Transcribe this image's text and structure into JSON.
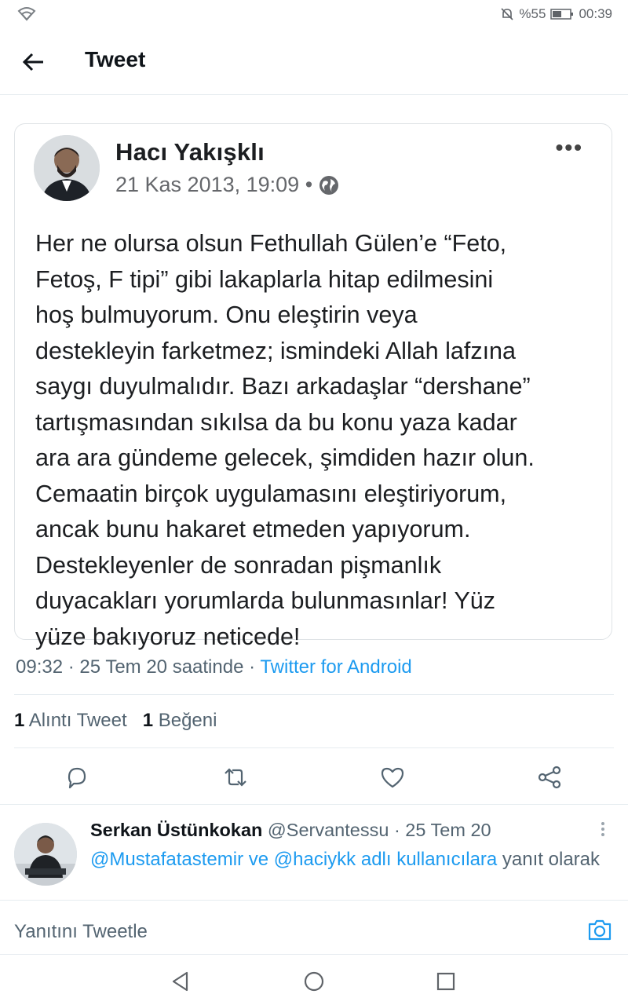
{
  "status_bar": {
    "battery": "%55",
    "time": "00:39"
  },
  "header": {
    "title": "Tweet"
  },
  "embedded_post": {
    "author": "Hacı Yakışklı",
    "date": "21 Kas 2013, 19:09 •",
    "more": "•••",
    "text": "Her ne olursa olsun Fethullah Gülen’e “Feto,\nFetoş, F tipi” gibi lakaplarla hitap edilmesini\nhoş bulmuyorum. Onu eleştirin veya\ndestekleyin farketmez; ismindeki Allah lafzına\nsaygı duyulmalıdır. Bazı arkadaşlar “dershane”\ntartışmasından sıkılsa da bu konu yaza kadar\nara ara gündeme gelecek, şimdiden hazır olun.\nCemaatin birçok uygulamasını eleştiriyorum,\nancak bunu hakaret etmeden yapıyorum.\nDestekleyenler de sonradan pişmanlık\nduyacakları yorumlarda bulunmasınlar! Yüz\nyüze bakıyoruz neticede!"
  },
  "tweet_meta": {
    "time_date": "09:32 · 25 Tem 20 saatinde · ",
    "source": "Twitter for Android"
  },
  "stats": {
    "quote_count": "1",
    "quote_label": "Alıntı Tweet",
    "like_count": "1",
    "like_label": "Beğeni"
  },
  "actions": [
    "reply-icon",
    "retweet-icon",
    "like-icon",
    "share-icon"
  ],
  "reply": {
    "name": "Serkan Üstünkokan",
    "handle_date": " @Servantessu · 25 Tem 20",
    "mention_1": "@Mustafatastemir",
    "connector": " ve ",
    "mention_2": "@haciykk adlı kullanıcılara",
    "suffix": " yanıt olarak"
  },
  "compose": {
    "placeholder": "Yanıtını Tweetle"
  },
  "colors": {
    "accent": "#1d9bf0",
    "secondary_text": "#536471"
  }
}
